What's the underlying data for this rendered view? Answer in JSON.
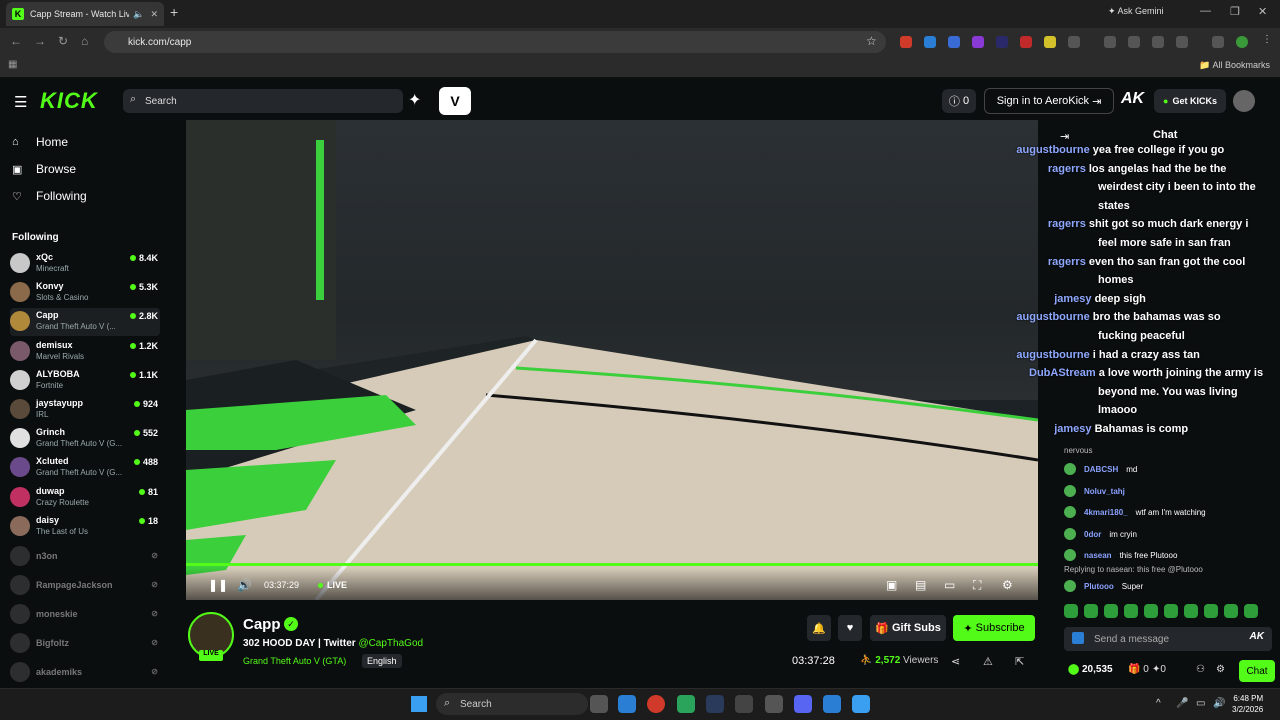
{
  "browser": {
    "tab_title": "Capp Stream - Watch Live ...",
    "favicon_letter": "K",
    "url": "kick.com/capp",
    "ask_gemini": "Ask Gemini",
    "all_bookmarks": "All Bookmarks"
  },
  "header": {
    "logo": "KICK",
    "search_placeholder": "Search",
    "points": "0",
    "signin_label": "Sign in to AeroKick",
    "aerok_logo": "AK",
    "get_kicks": "Get KICKs"
  },
  "nav": {
    "home": "Home",
    "browse": "Browse",
    "following": "Following"
  },
  "sidebar": {
    "following_header": "Following",
    "channels": [
      {
        "name": "xQc",
        "game": "Minecraft",
        "viewers": "8.4K",
        "color": "#c8c8c8"
      },
      {
        "name": "Konvy",
        "game": "Slots & Casino",
        "viewers": "5.3K",
        "color": "#8a6a4a"
      },
      {
        "name": "Capp",
        "game": "Grand Theft Auto V (...",
        "viewers": "2.8K",
        "color": "#b08a3a"
      },
      {
        "name": "demisux",
        "game": "Marvel Rivals",
        "viewers": "1.2K",
        "color": "#7a5a6a"
      },
      {
        "name": "ALYBOBA",
        "game": "Fortnite",
        "viewers": "1.1K",
        "color": "#d0d0d0"
      },
      {
        "name": "jaystayupp",
        "game": "IRL",
        "viewers": "924",
        "color": "#5a4a3a"
      },
      {
        "name": "Grinch",
        "game": "Grand Theft Auto V (G...",
        "viewers": "552",
        "color": "#e0e0e0"
      },
      {
        "name": "Xcluted",
        "game": "Grand Theft Auto V (G...",
        "viewers": "488",
        "color": "#6a4a8a"
      },
      {
        "name": "duwap",
        "game": "Crazy Roulette",
        "viewers": "81",
        "color": "#c03060"
      },
      {
        "name": "daisy",
        "game": "The Last of Us",
        "viewers": "18",
        "color": "#8a6a5a"
      }
    ],
    "offline": [
      {
        "name": "n3on"
      },
      {
        "name": "RampageJackson"
      },
      {
        "name": "moneskie"
      },
      {
        "name": "Bigfoltz"
      },
      {
        "name": "akademiks"
      }
    ]
  },
  "player": {
    "time": "03:37:29",
    "live": "LIVE"
  },
  "stream": {
    "channel": "Capp",
    "live_badge": "LIVE",
    "title_prefix": "302 HOOD DAY | Twitter",
    "twitter": "@CapThaGod",
    "game": "Grand Theft Auto V (GTA)",
    "language": "English",
    "gift_subs": "Gift Subs",
    "subscribe": "Subscribe",
    "uptime": "03:37:28",
    "viewers_count": "2,572",
    "viewers_label": "Viewers"
  },
  "chat": {
    "header": "Chat",
    "overlay_messages": [
      {
        "user": "augustbourne",
        "text": "yea free college if you go"
      },
      {
        "user": "ragerrs",
        "text": "los angelas had the be the"
      },
      {
        "user": "",
        "text": "weirdest city i been to into the"
      },
      {
        "user": "",
        "text": "states"
      },
      {
        "user": "ragerrs",
        "text": "shit got so much dark energy i"
      },
      {
        "user": "",
        "text": "feel more safe in san fran"
      },
      {
        "user": "ragerrs",
        "text": "even tho san fran got the cool"
      },
      {
        "user": "",
        "text": "homes"
      },
      {
        "user": "jamesy",
        "text": "deep sigh"
      },
      {
        "user": "augustbourne",
        "text": "bro the bahamas was so"
      },
      {
        "user": "",
        "text": "fucking peaceful"
      },
      {
        "user": "augustbourne",
        "text": "i had a crazy ass tan"
      },
      {
        "user": "DubAStream",
        "text": "a love worth joining the army is"
      },
      {
        "user": "",
        "text": "beyond me. You was living"
      },
      {
        "user": "",
        "text": "lmaooo"
      },
      {
        "user": "jamesy",
        "text": "Bahamas is comp"
      }
    ],
    "messages": [
      {
        "user": "",
        "text": "nervous"
      },
      {
        "user": "DABCSH",
        "text": "md"
      },
      {
        "user": "Noluv_tahj",
        "text": ""
      },
      {
        "user": "4kmari180_",
        "text": "wtf am I'm watching"
      },
      {
        "user": "0dor",
        "text": "im cryin"
      },
      {
        "user": "nasean",
        "text": "this free  Plutooo"
      },
      {
        "user": "",
        "text": "Replying to nasean: this free @Plutooo"
      },
      {
        "user": "Plutooo",
        "text": "Super"
      }
    ],
    "input_placeholder": "Send a message",
    "input_logo": "AK",
    "points": "20,535",
    "count_a": "0",
    "count_b": "0",
    "chat_button": "Chat"
  },
  "taskbar": {
    "search": "Search",
    "time": "6:48 PM",
    "date": "3/2/2026"
  }
}
